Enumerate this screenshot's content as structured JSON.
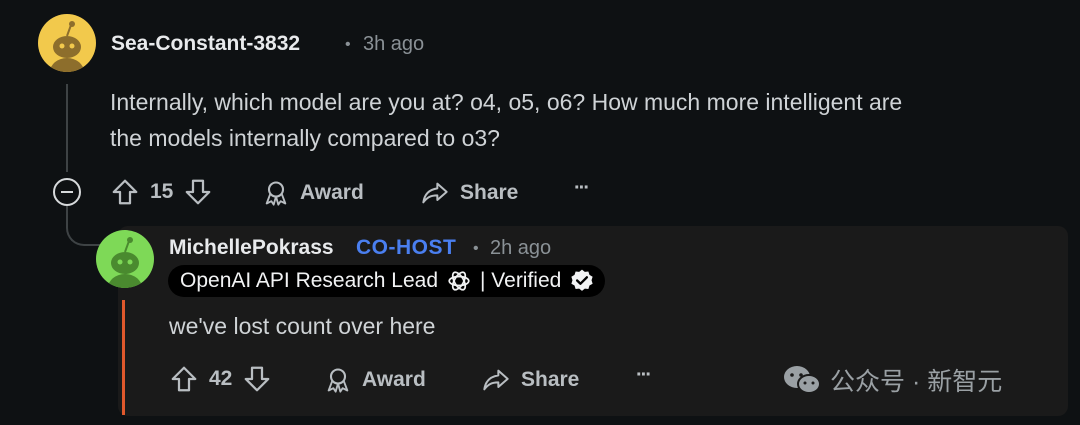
{
  "comment": {
    "username": "Sea-Constant-3832",
    "separator": "•",
    "time": "3h ago",
    "text_line1": "Internally, which model are you at? o4, o5, o6? How much more intelligent are",
    "text_line2": "the models internally compared to o3?",
    "votes": "15",
    "award_label": "Award",
    "share_label": "Share",
    "more_label": "···"
  },
  "reply": {
    "username": "MichellePokrass",
    "role_badge": "CO-HOST",
    "separator": "•",
    "time": "2h ago",
    "flair_text": "OpenAI API Research Lead",
    "flair_suffix": "| Verified",
    "text": "we've lost count over here",
    "votes": "42",
    "award_label": "Award",
    "share_label": "Share",
    "more_label": "···"
  },
  "watermark": {
    "text": "公众号 · 新智元"
  },
  "colors": {
    "background": "#0e1113",
    "reply_background": "#1a1a1a",
    "accent_bar": "#e0582c",
    "cohost": "#4a7ff0",
    "avatar1": "#f2c94c",
    "avatar2": "#7ed957"
  }
}
